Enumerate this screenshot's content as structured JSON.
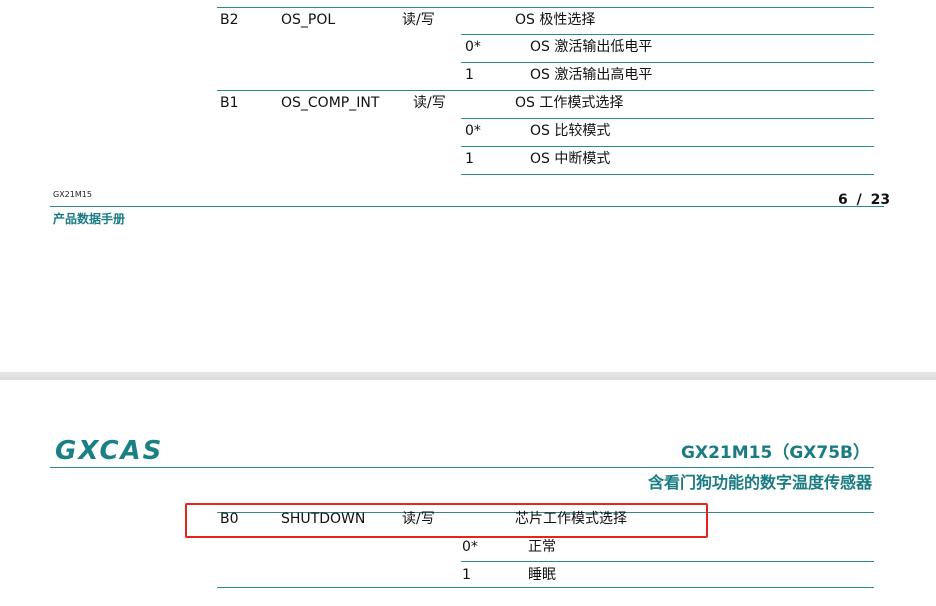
{
  "page1": {
    "rows": [
      {
        "bit": "B2",
        "name": "OS_POL",
        "access": "读/写",
        "desc": "OS 极性选择"
      },
      {
        "value": "0*",
        "meaning": "OS 激活输出低电平"
      },
      {
        "value": "1",
        "meaning": "OS 激活输出高电平"
      },
      {
        "bit": "B1",
        "name": "OS_COMP_INT",
        "access": "读/写",
        "desc": "OS  工作模式选择"
      },
      {
        "value": "0*",
        "meaning": "OS  比较模式"
      },
      {
        "value": "1",
        "meaning": "OS 中断模式"
      }
    ],
    "footer": {
      "doc_id": "GX21M15",
      "doc_type": "产品数据手册",
      "page_current": "6",
      "page_sep": "/",
      "page_total": "23"
    }
  },
  "page2": {
    "header": {
      "logo_text": "GXCAS",
      "title": "GX21M15（GX75B）",
      "subtitle": "含看门狗功能的数字温度传感器"
    },
    "rows": [
      {
        "bit": "B0",
        "name": "SHUTDOWN",
        "access": "读/写",
        "desc": "芯片工作模式选择"
      },
      {
        "value": "0*",
        "meaning": "正常"
      },
      {
        "value": "1",
        "meaning": "睡眠"
      }
    ],
    "highlight_color": "#e8231c",
    "accent_color": "#1a7c82"
  }
}
